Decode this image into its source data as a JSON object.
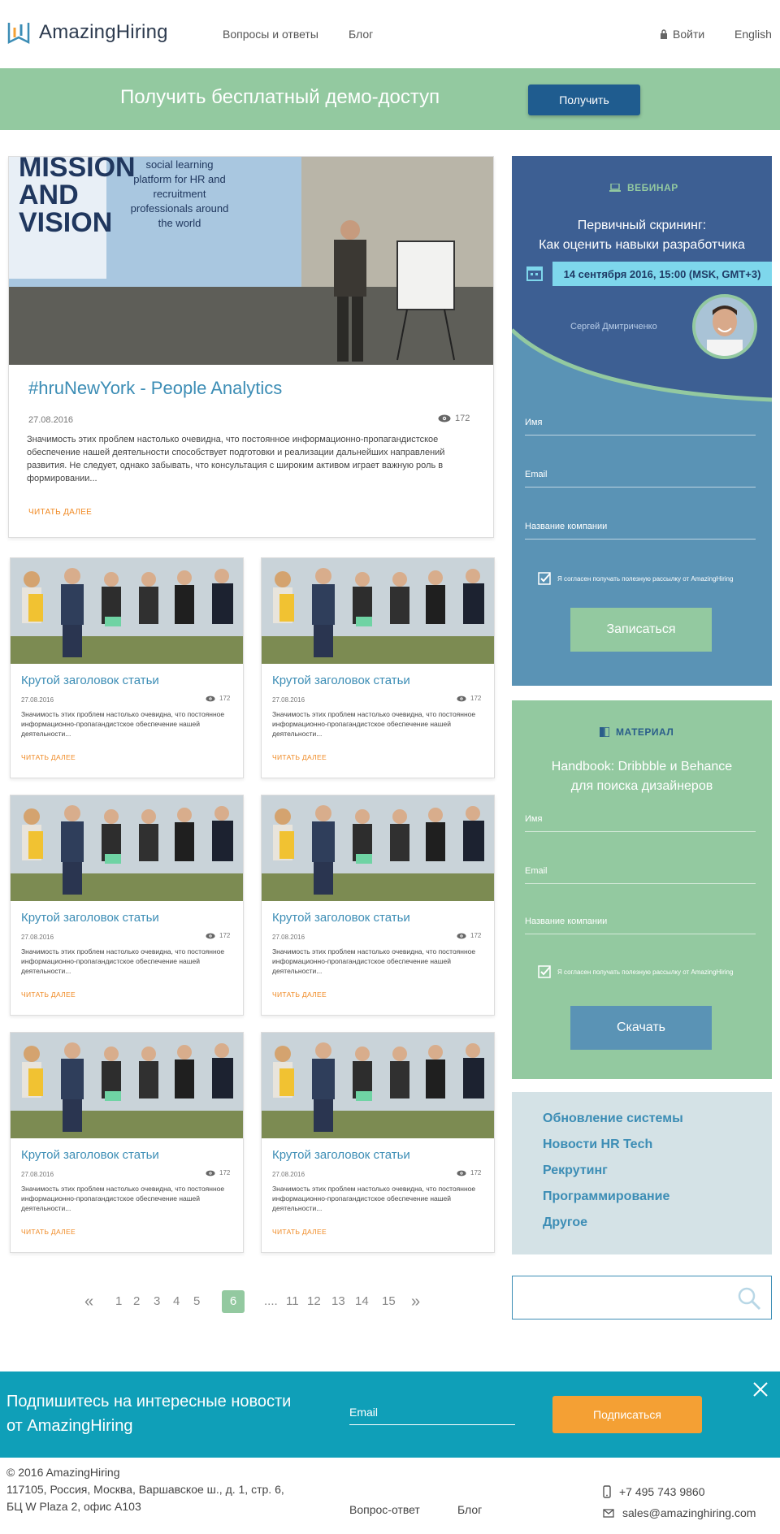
{
  "header": {
    "logo_text": "AmazingHiring",
    "nav": [
      "Вопросы и ответы",
      "Блог"
    ],
    "login_label": "Войти",
    "language_label": "English"
  },
  "promo": {
    "text": "Получить бесплатный демо-доступ",
    "button_label": "Получить"
  },
  "featured_post": {
    "image_text": [
      "MISSION",
      "AND",
      "VISION"
    ],
    "image_caption": [
      "social learning",
      "platform for HR and",
      "recruitment",
      "professionals around",
      "the world"
    ],
    "title": "#hruNewYork - People Analytics",
    "date": "27.08.2016",
    "views": "172",
    "excerpt": "Значимость этих проблем настолько очевидна, что постоянное информационно-пропагандистское обеспечение нашей деятельности способствует подготовки и реализации дальнейших направлений развития. Не следует, однако забывать, что консультация с широким активом играет важную роль в формировании...",
    "read_more": "ЧИТАТЬ ДАЛЕЕ"
  },
  "cards": [
    {
      "title": "Крутой заголовок статьи",
      "date": "27.08.2016",
      "views": "172",
      "excerpt": "Значимость этих проблем настолько очевидна, что постоянное информационно-пропагандистское обеспечение нашей деятельности...",
      "read_more": "ЧИТАТЬ ДАЛЕЕ"
    },
    {
      "title": "Крутой заголовок статьи",
      "date": "27.08.2016",
      "views": "172",
      "excerpt": "Значимость этих проблем настолько очевидна, что постоянное информационно-пропагандистское обеспечение нашей деятельности...",
      "read_more": "ЧИТАТЬ ДАЛЕЕ"
    },
    {
      "title": "Крутой заголовок статьи",
      "date": "27.08.2016",
      "views": "172",
      "excerpt": "Значимость этих проблем настолько очевидна, что постоянное информационно-пропагандистское обеспечение нашей деятельности...",
      "read_more": "ЧИТАТЬ ДАЛЕЕ"
    },
    {
      "title": "Крутой заголовок статьи",
      "date": "27.08.2016",
      "views": "172",
      "excerpt": "Значимость этих проблем настолько очевидна, что постоянное информационно-пропагандистское обеспечение нашей деятельности...",
      "read_more": "ЧИТАТЬ ДАЛЕЕ"
    },
    {
      "title": "Крутой заголовок статьи",
      "date": "27.08.2016",
      "views": "172",
      "excerpt": "Значимость этих проблем настолько очевидна, что постоянное информационно-пропагандистское обеспечение нашей деятельности...",
      "read_more": "ЧИТАТЬ ДАЛЕЕ"
    },
    {
      "title": "Крутой заголовок статьи",
      "date": "27.08.2016",
      "views": "172",
      "excerpt": "Значимость этих проблем настолько очевидна, что постоянное информационно-пропагандистское обеспечение нашей деятельности...",
      "read_more": "ЧИТАТЬ ДАЛЕЕ"
    }
  ],
  "pagination": {
    "prev": "«",
    "pages": [
      "1",
      "2",
      "3",
      "4",
      "5",
      "6",
      "....",
      "11",
      "12",
      "13",
      "14",
      "15"
    ],
    "current": "6",
    "next": "»"
  },
  "webinar": {
    "tag": "ВЕБИНАР",
    "title_line1": "Первичный скрининг:",
    "title_line2": "Как оценить навыки разработчика",
    "date": "14 сентября 2016, 15:00 (MSK, GMT+3)",
    "speaker": "Сергей Дмитриченко",
    "fields": [
      "Имя",
      "Email",
      "Название компании"
    ],
    "consent": "Я согласен получать полезную рассылку от AmazingHiring",
    "submit_label": "Записаться"
  },
  "material": {
    "tag": "МАТЕРИАЛ",
    "title_line1": "Handbook: Dribbble и Behance",
    "title_line2": "для поиска дизайнеров",
    "fields": [
      "Имя",
      "Email",
      "Название компании"
    ],
    "consent": "Я согласен получать полезную рассылку от AmazingHiring",
    "submit_label": "Скачать"
  },
  "categories": [
    "Обновление системы",
    "Новости HR Tech",
    "Рекрутинг",
    "Программирование",
    "Другое"
  ],
  "search": {
    "placeholder": ""
  },
  "subscribe": {
    "text_line1": "Подпишитесь на интересные новости",
    "text_line2": "от  AmazingHiring",
    "email_label": "Email",
    "button_label": "Подписаться"
  },
  "footer": {
    "copyright": "© 2016 AmazingHiring",
    "address_line1": "117105, Россия, Москва, Варшавское ш., д. 1, стр. 6,",
    "address_line2": "БЦ W Plaza 2, офис А103",
    "links": [
      "Вопрос-ответ",
      "Блог"
    ],
    "phone": "+7 495 743 9860",
    "email": "sales@amazinghiring.com"
  },
  "colors": {
    "promo_green": "#93c9a0",
    "primary_blue": "#1f5c8f",
    "webinar_navy": "#3d5f93",
    "webinar_teal": "#5a93b5",
    "link_blue": "#3c8db5",
    "accent_orange": "#f08a24",
    "subscribe_teal": "#0f9fb8"
  }
}
